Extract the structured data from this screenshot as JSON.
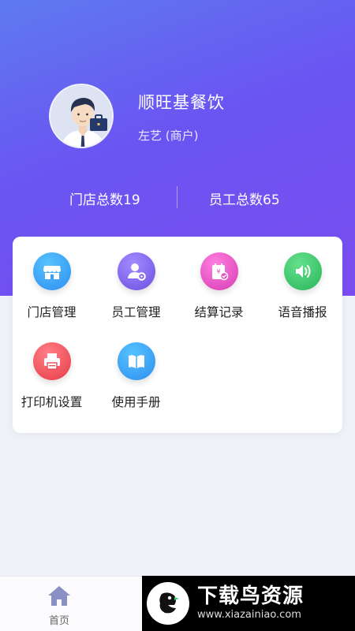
{
  "profile": {
    "shop_name": "顺旺基餐饮",
    "user_line": "左艺 (商户)"
  },
  "stats": {
    "stores": "门店总数19",
    "employees": "员工总数65"
  },
  "menu": {
    "items": [
      {
        "label": "门店管理",
        "icon": "store-icon"
      },
      {
        "label": "员工管理",
        "icon": "employee-settings-icon"
      },
      {
        "label": "结算记录",
        "icon": "settlement-icon"
      },
      {
        "label": "语音播报",
        "icon": "speaker-icon"
      },
      {
        "label": "打印机设置",
        "icon": "printer-icon"
      },
      {
        "label": "使用手册",
        "icon": "book-icon"
      }
    ]
  },
  "tabbar": {
    "home_label": "首页"
  },
  "watermark": {
    "title": "下载鸟资源",
    "url": "www.xiazainiao.com"
  },
  "colors": {
    "hero_start": "#5e7af0",
    "hero_end": "#7a4cf0",
    "store": "#2f9cf0",
    "employee": "#7b5ce8",
    "settlement": "#e852c5",
    "speaker": "#37c56b",
    "printer": "#f0505a",
    "book": "#2f9cf0"
  }
}
